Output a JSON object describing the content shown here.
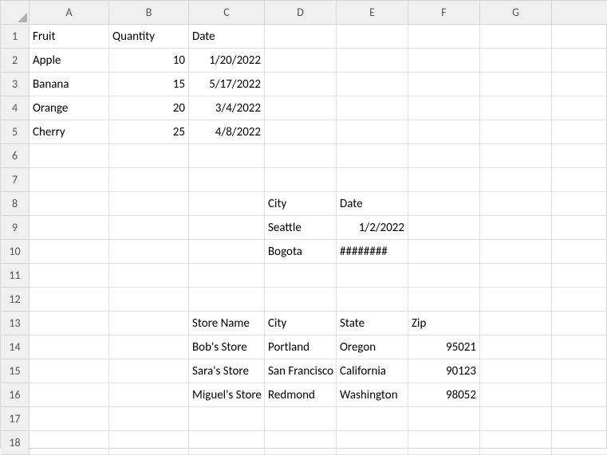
{
  "columns": [
    "A",
    "B",
    "C",
    "D",
    "E",
    "F",
    "G",
    ""
  ],
  "rows": [
    "1",
    "2",
    "3",
    "4",
    "5",
    "6",
    "7",
    "8",
    "9",
    "10",
    "11",
    "12",
    "13",
    "14",
    "15",
    "16",
    "17",
    "18"
  ],
  "cells": {
    "A1": "Fruit",
    "B1": "Quantity",
    "C1": "Date",
    "A2": "Apple",
    "B2": "10",
    "C2": "1/20/2022",
    "A3": "Banana",
    "B3": "15",
    "C3": "5/17/2022",
    "A4": "Orange",
    "B4": "20",
    "C4": "3/4/2022",
    "A5": "Cherry",
    "B5": "25",
    "C5": "4/8/2022",
    "D8": "City",
    "E8": "Date",
    "D9": "Seattle",
    "E9": "1/2/2022",
    "D10": "Bogota",
    "E10": "########",
    "C13": "Store Name",
    "D13": "City",
    "E13": "State",
    "F13": "Zip",
    "C14": "Bob's Store",
    "D14": "Portland",
    "E14": "Oregon",
    "F14": "95021",
    "C15": "Sara's Store",
    "D15": "San Francisco",
    "E15": "California",
    "F15": "90123",
    "C16": "Miguel's Store",
    "D16": "Redmond",
    "E16": "Washington",
    "F16": "98052"
  },
  "chart_data": [
    {
      "type": "table",
      "title": "Fruit Quantities",
      "columns": [
        "Fruit",
        "Quantity",
        "Date"
      ],
      "rows": [
        [
          "Apple",
          10,
          "1/20/2022"
        ],
        [
          "Banana",
          15,
          "5/17/2022"
        ],
        [
          "Orange",
          20,
          "3/4/2022"
        ],
        [
          "Cherry",
          25,
          "4/8/2022"
        ]
      ]
    },
    {
      "type": "table",
      "title": "City Dates",
      "columns": [
        "City",
        "Date"
      ],
      "rows": [
        [
          "Seattle",
          "1/2/2022"
        ],
        [
          "Bogota",
          "########"
        ]
      ]
    },
    {
      "type": "table",
      "title": "Stores",
      "columns": [
        "Store Name",
        "City",
        "State",
        "Zip"
      ],
      "rows": [
        [
          "Bob's Store",
          "Portland",
          "Oregon",
          95021
        ],
        [
          "Sara's Store",
          "San Francisco",
          "California",
          90123
        ],
        [
          "Miguel's Store",
          "Redmond",
          "Washington",
          98052
        ]
      ]
    }
  ]
}
